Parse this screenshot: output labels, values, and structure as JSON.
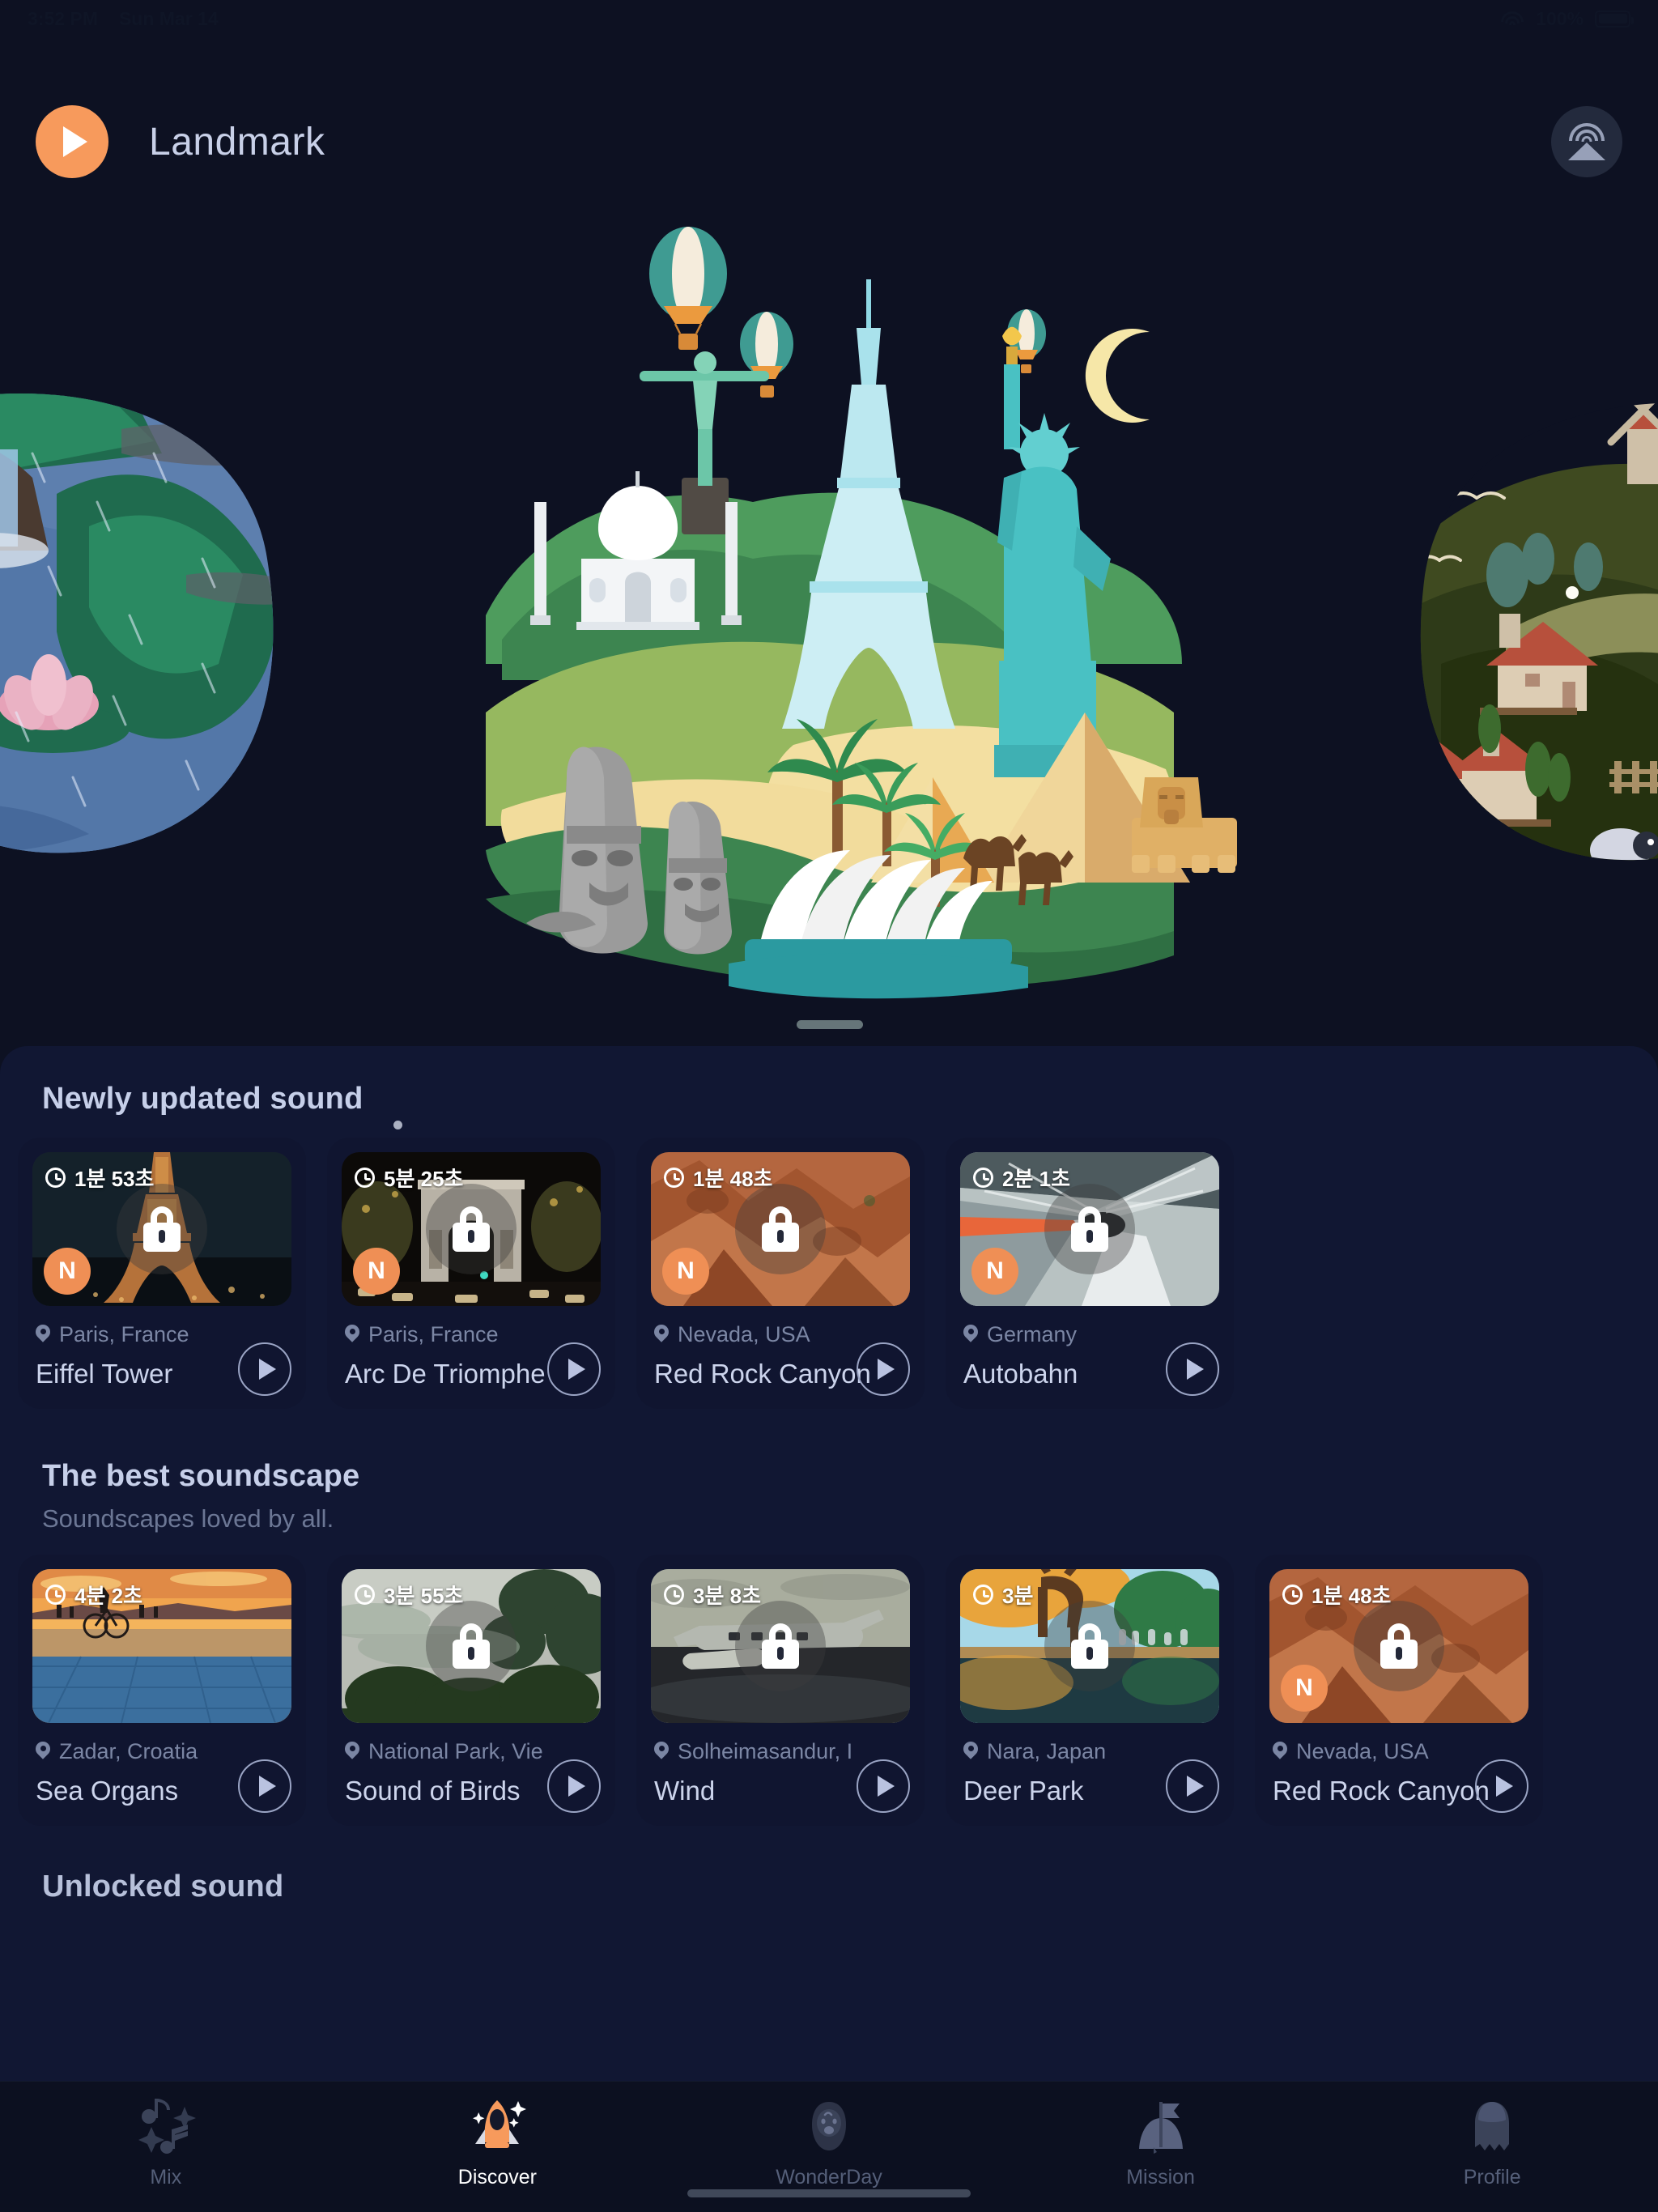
{
  "statusbar": {
    "time": "3:52 PM",
    "date": "Sun Mar 14",
    "battery_percent": "100%",
    "wifi_icon": "wifi-icon",
    "battery_icon": "battery-full-icon"
  },
  "header": {
    "title": "Landmark",
    "play_icon": "play-icon",
    "airplay_icon": "airplay-icon"
  },
  "hero": {
    "name": "landmark-illustration",
    "scenes": [
      "rain-water-scene",
      "landmark-world-scene",
      "countryside-village-scene"
    ],
    "active_dot_index": 0
  },
  "sections": [
    {
      "id": "newly-updated-sound",
      "title": "Newly updated sound",
      "subtitle": "",
      "cards": [
        {
          "duration": "1분 53초",
          "location": "Paris, France",
          "name": "Eiffel Tower",
          "locked": true,
          "new_badge": "N",
          "thumb": "eiffel-tower-photo"
        },
        {
          "duration": "5분 25초",
          "location": "Paris, France",
          "name": "Arc De Triomphe",
          "locked": true,
          "new_badge": "N",
          "thumb": "arc-de-triomphe-photo"
        },
        {
          "duration": "1분 48초",
          "location": "Nevada, USA",
          "name": "Red Rock Canyon",
          "locked": true,
          "new_badge": "N",
          "thumb": "red-rock-canyon-photo"
        },
        {
          "duration": "2분 1초",
          "location": "Germany",
          "name": "Autobahn",
          "locked": true,
          "new_badge": "N",
          "thumb": "autobahn-tunnel-photo"
        }
      ]
    },
    {
      "id": "the-best-soundscape",
      "title": "The best soundscape",
      "subtitle": "Soundscapes loved by all.",
      "cards": [
        {
          "duration": "4분 2초",
          "location": "Zadar, Croatia",
          "name": "Sea Organs",
          "locked": false,
          "new_badge": "",
          "thumb": "sea-organs-sunset-photo"
        },
        {
          "duration": "3분 55초",
          "location": "National Park, Vie",
          "name": "Sound of Birds",
          "locked": true,
          "new_badge": "",
          "thumb": "misty-forest-photo"
        },
        {
          "duration": "3분 8초",
          "location": "Solheimasandur, I",
          "name": "Wind",
          "locked": true,
          "new_badge": "",
          "thumb": "plane-wreck-photo"
        },
        {
          "duration": "3분",
          "location": "Nara, Japan",
          "name": "Deer Park",
          "locked": true,
          "new_badge": "",
          "thumb": "deer-park-autumn-photo"
        },
        {
          "duration": "1분 48초",
          "location": "Nevada, USA",
          "name": "Red Rock Canyon",
          "locked": true,
          "new_badge": "N",
          "thumb": "red-rock-canyon-photo"
        }
      ]
    }
  ],
  "cut_section_title": "Unlocked sound",
  "tabbar": {
    "items": [
      {
        "label": "Mix",
        "icon": "music-notes-icon",
        "active": false
      },
      {
        "label": "Discover",
        "icon": "rocket-icon",
        "active": true
      },
      {
        "label": "WonderDay",
        "icon": "sleeping-face-icon",
        "active": false
      },
      {
        "label": "Mission",
        "icon": "flag-hill-icon",
        "active": false
      },
      {
        "label": "Profile",
        "icon": "ghost-person-icon",
        "active": false
      }
    ]
  },
  "colors": {
    "background": "#0d1122",
    "sheet": "#111733",
    "accent": "#f79a5c",
    "text_primary": "#ccd4ec",
    "text_muted": "#7b86a4"
  }
}
